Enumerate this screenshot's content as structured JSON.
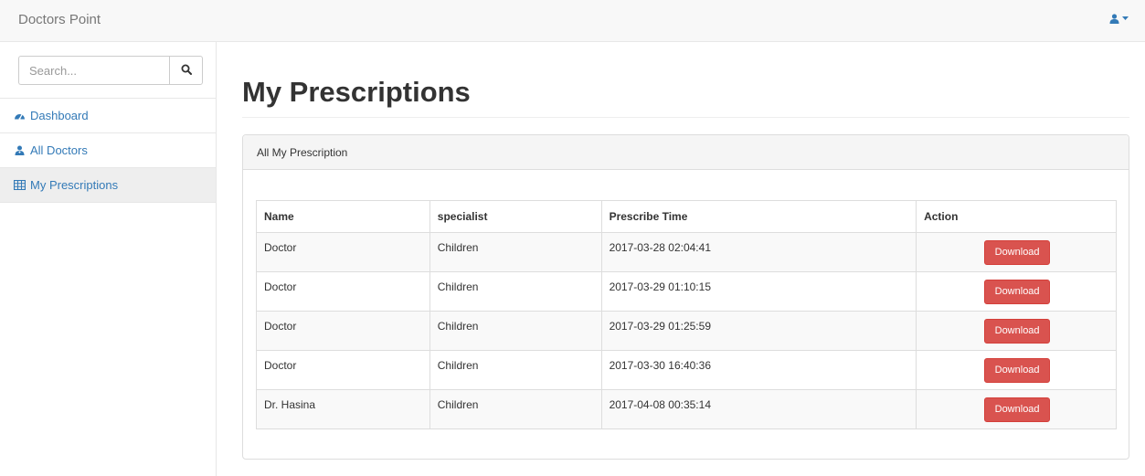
{
  "navbar": {
    "brand": "Doctors Point",
    "user_icon": "user-icon",
    "caret_icon": "caret-down-icon"
  },
  "sidebar": {
    "search": {
      "placeholder": "Search...",
      "value": "",
      "icon": "search-icon"
    },
    "items": [
      {
        "label": "Dashboard",
        "icon": "dashboard-icon",
        "active": false
      },
      {
        "label": "All Doctors",
        "icon": "users-icon",
        "active": false
      },
      {
        "label": "My Prescriptions",
        "icon": "table-icon",
        "active": true
      }
    ]
  },
  "main": {
    "title": "My Prescriptions",
    "panel": {
      "heading": "All My Prescription",
      "table": {
        "headers": [
          "Name",
          "specialist",
          "Prescribe Time",
          "Action"
        ],
        "rows": [
          {
            "name": "Doctor",
            "specialist": "Children",
            "time": "2017-03-28 02:04:41",
            "action": "Download"
          },
          {
            "name": "Doctor",
            "specialist": "Children",
            "time": "2017-03-29 01:10:15",
            "action": "Download"
          },
          {
            "name": "Doctor",
            "specialist": "Children",
            "time": "2017-03-29 01:25:59",
            "action": "Download"
          },
          {
            "name": "Doctor",
            "specialist": "Children",
            "time": "2017-03-30 16:40:36",
            "action": "Download"
          },
          {
            "name": "Dr. Hasina",
            "specialist": "Children",
            "time": "2017-04-08 00:35:14",
            "action": "Download"
          }
        ]
      }
    }
  },
  "colors": {
    "link": "#337ab7",
    "danger": "#d9534f",
    "navbar_bg": "#f8f8f8",
    "active_bg": "#eeeeee"
  }
}
